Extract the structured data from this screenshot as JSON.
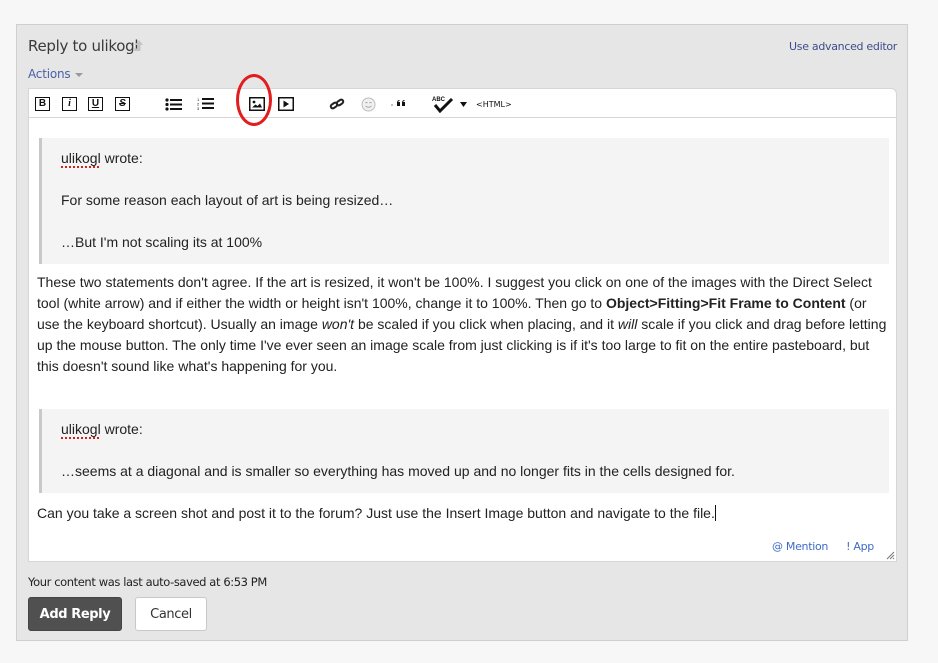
{
  "header": {
    "title": "Reply to ulikogl",
    "title_icon": "upload-arrow-icon",
    "advanced_editor_link": "Use advanced editor",
    "actions_label": "Actions"
  },
  "toolbar": {
    "buttons": [
      {
        "name": "bold",
        "glyph": "B"
      },
      {
        "name": "italic",
        "glyph": "i"
      },
      {
        "name": "underline",
        "glyph": "U"
      },
      {
        "name": "strikethrough",
        "glyph": "S"
      },
      {
        "name": "bullet-list",
        "glyph": "bullets"
      },
      {
        "name": "numbered-list",
        "glyph": "numbers"
      },
      {
        "name": "insert-image",
        "glyph": "image",
        "highlighted": true
      },
      {
        "name": "insert-video",
        "glyph": "play"
      },
      {
        "name": "insert-link",
        "glyph": "link"
      },
      {
        "name": "emoji",
        "glyph": "smiley"
      },
      {
        "name": "blockquote",
        "glyph": "quote"
      },
      {
        "name": "spellcheck",
        "glyph": "ABC"
      },
      {
        "name": "html",
        "glyph": "<HTML>"
      }
    ],
    "spell_label": "ABC",
    "html_label": "<HTML>",
    "highlight_color": "#e21d1d"
  },
  "content": {
    "quote1": {
      "author": "ulikogl",
      "wrote": " wrote:",
      "line1": "For some reason each layout of art is being resized…",
      "line2": "…But I'm not scaling its at 100%"
    },
    "para1": {
      "t1": "These two statements don't agree. If the art is resized, it won't be 100%. I suggest you click on one of the images with the Direct Select tool (white arrow) and if either the width or height isn't 100%, change it to 100%. Then go to ",
      "bold": "Object>Fitting>Fit Frame to Content",
      "t2": " (or use the keyboard shortcut). Usually an image ",
      "em1": "won't",
      "t3": " be scaled if you click when placing, and it ",
      "em2": "will",
      "t4": " scale if you click and drag before letting up the mouse button. The only time I've ever seen an image scale from just clicking is if it's too large to fit on the entire pasteboard, but this doesn't sound like what's happening for you."
    },
    "quote2": {
      "author": "ulikogl",
      "wrote": " wrote:",
      "line1": "…seems at a diagonal and is smaller so everything has moved up and no longer fits in the cells designed for."
    },
    "para2": "Can you take a screen shot and post it to the forum? Just use the Insert Image button and navigate to the file."
  },
  "editor_footer": {
    "mention": "@ Mention",
    "app": "! App"
  },
  "autosave_text": "Your content was last auto-saved at 6:53 PM",
  "buttons": {
    "add_reply": "Add Reply",
    "cancel": "Cancel"
  }
}
